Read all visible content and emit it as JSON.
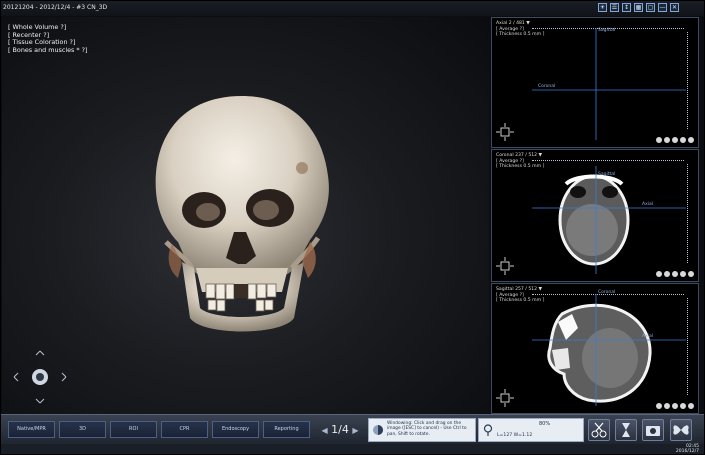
{
  "window": {
    "title": "20121204 - 2012/12/4 - #3 CN_3D",
    "controls": [
      "☀",
      "☰",
      "↕",
      "▦",
      "▢",
      "—",
      "✕"
    ]
  },
  "view3d": {
    "menu": [
      "[ Whole Volume ?]",
      "[ Recenter ?]",
      "[ Tissue Coloration ?]",
      "[ Bones and muscles * ?]"
    ]
  },
  "panels": {
    "axial": {
      "line1": "Axial 2 / 481 ▼",
      "line2": "[ Average ?]",
      "line3": "[ Thickness 0.5 mm ]",
      "label_top": "Sagittal",
      "label_side": "Coronal"
    },
    "coronal": {
      "line1": "Coronal 237 / 512 ▼",
      "line2": "[ Average ?]",
      "line3": "[ Thickness 0.5 mm ]",
      "label_top": "Sagittal",
      "label_side": "Axial"
    },
    "sagittal": {
      "line1": "Sagittal 257 / 512 ▼",
      "line2": "[ Average ?]",
      "line3": "[ Thickness 0.5 mm ]",
      "label_top": "Coronal",
      "label_side": "Axial"
    }
  },
  "toolbar": {
    "tabs": [
      "Native/MPR",
      "3D",
      "ROI",
      "CPR",
      "Endoscopy",
      "Reporting"
    ],
    "pager": "1/4",
    "hint": "Windowing: Click and drag on the image ([ESC] to cancel) - Use Ctrl to pan, Shift to rotate.",
    "zoom": "80%",
    "wl": "L=127 W=1.12"
  },
  "taskbar": {
    "time": "02:45",
    "date": "2016/12/7"
  },
  "colors": {
    "accent": "#4c5f86",
    "panel_border": "#3c4a5e",
    "crosshair": "#3c7bd8"
  }
}
